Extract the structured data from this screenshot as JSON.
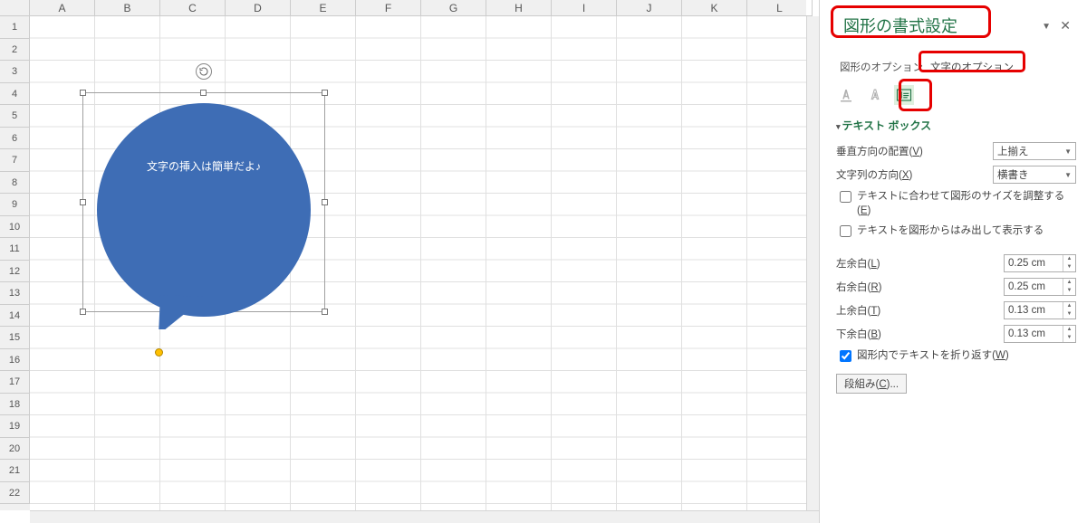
{
  "columns": [
    "A",
    "B",
    "C",
    "D",
    "E",
    "F",
    "G",
    "H",
    "I",
    "J",
    "K",
    "L"
  ],
  "rows": [
    "1",
    "2",
    "3",
    "4",
    "5",
    "6",
    "7",
    "8",
    "9",
    "10",
    "11",
    "12",
    "13",
    "14",
    "15",
    "16",
    "17",
    "18",
    "19",
    "20",
    "21",
    "22"
  ],
  "shape": {
    "text": "文字の挿入は簡単だよ♪"
  },
  "panel": {
    "title": "図形の書式設定",
    "tabs": {
      "shape_options": "図形のオプション",
      "text_options": "文字のオプション"
    },
    "section": "テキスト ボックス",
    "vertical_align": {
      "label": "垂直方向の配置(",
      "key": "V",
      "suffix": ")",
      "value": "上揃え"
    },
    "direction": {
      "label": "文字列の方向(",
      "key": "X",
      "suffix": ")",
      "value": "横書き"
    },
    "autofit_text": "テキストに合わせて図形のサイズを調整する(",
    "autofit_key": "E",
    "overflow_text": "テキストを図形からはみ出して表示する",
    "margins": {
      "left": {
        "label": "左余白(",
        "key": "L",
        "suffix": ")",
        "value": "0.25 cm"
      },
      "right": {
        "label": "右余白(",
        "key": "R",
        "suffix": ")",
        "value": "0.25 cm"
      },
      "top": {
        "label": "上余白(",
        "key": "T",
        "suffix": ")",
        "value": "0.13 cm"
      },
      "bottom": {
        "label": "下余白(",
        "key": "B",
        "suffix": ")",
        "value": "0.13 cm"
      }
    },
    "wrap": {
      "label": "図形内でテキストを折り返す(",
      "key": "W",
      "suffix": ")"
    },
    "columns_btn": {
      "label": "段組み(",
      "key": "C",
      "suffix": ")..."
    }
  }
}
